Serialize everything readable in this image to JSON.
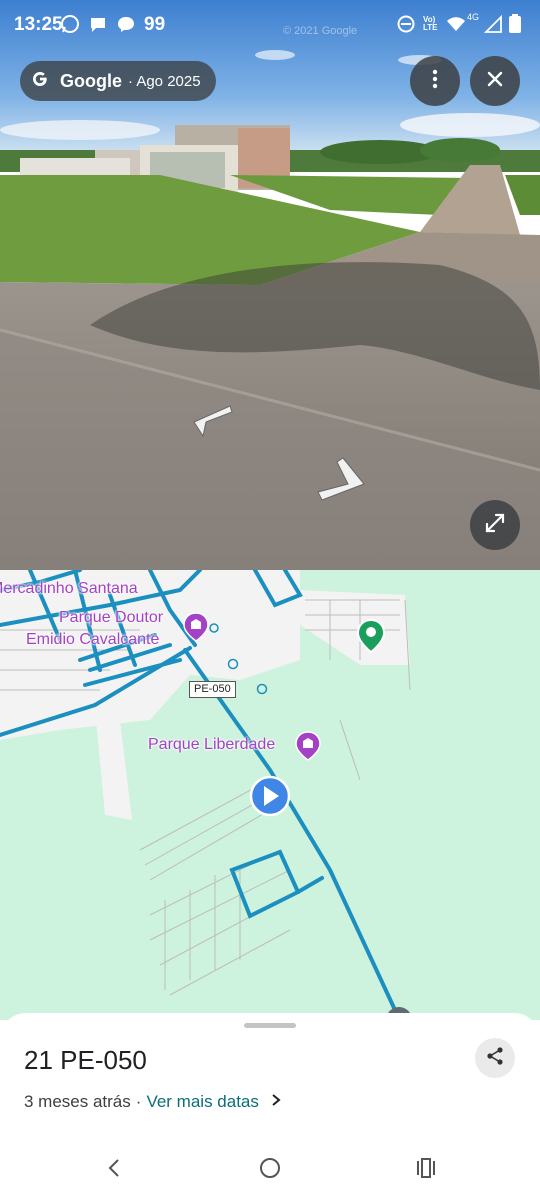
{
  "status_bar": {
    "time": "13:25",
    "notification_count": "99",
    "network_label": "4G",
    "volte_label": "Vo) LTE",
    "icons": [
      "whatsapp-icon",
      "chat-icon",
      "messenger-icon",
      "dnd-icon",
      "volte-icon",
      "wifi-icon",
      "signal-icon",
      "battery-icon"
    ]
  },
  "street_view": {
    "watermark": "© 2021 Google",
    "brand": "Google",
    "capture_date": "· Ago 2025",
    "more_icon": "more-vert-icon",
    "close_icon": "close-icon",
    "expand_icon": "expand-icon"
  },
  "map": {
    "labels": {
      "mercadinho": "Mercadinho Santana",
      "parque_doutor_1": "Parque Doutor",
      "parque_doutor_2": "Emidio Cavalcante",
      "parque_liberdade": "Parque Liberdade",
      "road_shield": "PE-050"
    },
    "colors": {
      "background": "#cdf2dd",
      "road": "#1b8fbf",
      "poi": "#a442c6",
      "location": "#3f86e6",
      "pin": "#1a9e5b"
    }
  },
  "bottom_sheet": {
    "title": "21 PE-050",
    "age": "3 meses atrás",
    "separator": "·",
    "more_dates": "Ver mais datas",
    "share_icon": "share-icon"
  },
  "nav_bar": {
    "buttons": [
      "back-icon",
      "home-icon",
      "recents-icon"
    ]
  }
}
